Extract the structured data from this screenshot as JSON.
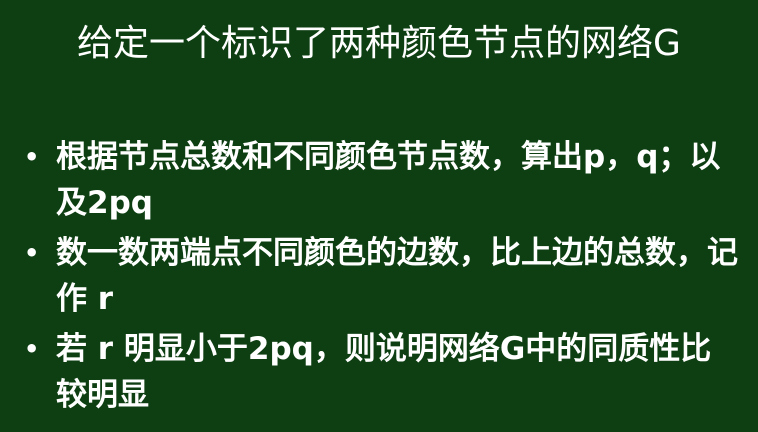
{
  "slide": {
    "title": "给定一个标识了两种颜色节点的网络G",
    "bullet_symbol": "•",
    "bullets": [
      {
        "text": "根据节点总数和不同颜色节点数，算出p，q；以及2pq"
      },
      {
        "text": "数一数两端点不同颜色的边数，比上边的总数，记作 r"
      },
      {
        "text": "若 r 明显小于2pq，则说明网络G中的同质性比较明显"
      }
    ],
    "colors": {
      "background": "#0e3f13",
      "text": "#ffffff"
    }
  }
}
